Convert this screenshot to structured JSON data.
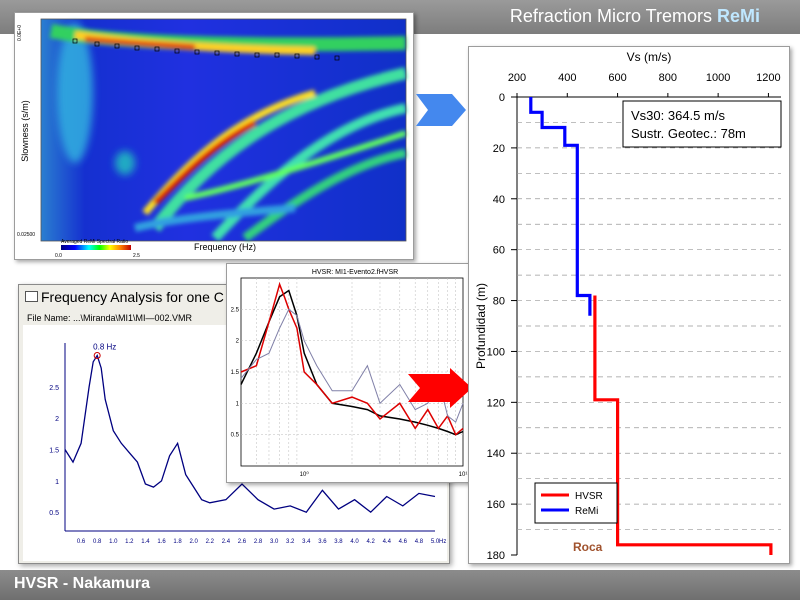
{
  "header": {
    "title_main": "Refraction Micro Tremors",
    "title_accent": "ReMi"
  },
  "footer": {
    "title": "HVSR - Nakamura"
  },
  "remi_panel": {
    "ylabel": "Slowness (s/m)",
    "xlabel": "Frequency (Hz)",
    "y_top": "0.0E+0",
    "y_bottom": "0.02500",
    "colorbar_label": "Averaged ReMi Spectral Ratio",
    "colorbar_min": "0.0",
    "colorbar_max": "2.5"
  },
  "freq_window": {
    "title": "Frequency Analysis for one C",
    "file_name": "File Name: ...\\Miranda\\MI1\\MI—002.VMR",
    "peak_label": "0.8 Hz"
  },
  "hvsr_inset": {
    "title": "HVSR: MI1-Evento2.fHVSR"
  },
  "profile": {
    "annotation_line1": "Vs30: 364.5 m/s",
    "annotation_line2": "Sustr. Geotec.: 78m",
    "rock_label": "Roca"
  },
  "chart_data": [
    {
      "type": "line",
      "id": "vs-profile",
      "title": "",
      "xlabel": "Vs (m/s)",
      "ylabel": "Profundidad (m)",
      "xlim": [
        200,
        1250
      ],
      "ylim": [
        0,
        180
      ],
      "x_ticks": [
        200,
        400,
        600,
        800,
        1000,
        1200
      ],
      "y_ticks": [
        0,
        20,
        40,
        60,
        80,
        100,
        120,
        140,
        160,
        180
      ],
      "y_inverted": true,
      "grid": true,
      "legend_position": "bottom-left",
      "series": [
        {
          "name": "HVSR",
          "color": "#ff0000",
          "points": [
            [
              510,
              78
            ],
            [
              510,
              119
            ],
            [
              600,
              119
            ],
            [
              600,
              176
            ],
            [
              1210,
              176
            ],
            [
              1210,
              180
            ]
          ]
        },
        {
          "name": "ReMi",
          "color": "#0000ff",
          "points": [
            [
              255,
              0
            ],
            [
              255,
              6
            ],
            [
              300,
              6
            ],
            [
              300,
              12
            ],
            [
              390,
              12
            ],
            [
              390,
              19
            ],
            [
              440,
              19
            ],
            [
              440,
              78
            ],
            [
              490,
              78
            ],
            [
              490,
              86
            ]
          ]
        }
      ]
    },
    {
      "type": "line",
      "id": "hv-spectrum",
      "title": "",
      "xlabel": "",
      "ylabel": "",
      "xlim": [
        0.4,
        5.0
      ],
      "ylim": [
        0.2,
        3.2
      ],
      "x_tick_labels": [
        "0.6",
        "0.8",
        "1.0",
        "1.2",
        "1.4",
        "1.6",
        "1.8",
        "2.0",
        "2.2",
        "2.4",
        "2.6",
        "2.8",
        "3.0",
        "3.2",
        "3.4",
        "3.6",
        "3.8",
        "4.0",
        "4.2",
        "4.4",
        "4.6",
        "4.8",
        "5.0"
      ],
      "x_unit": "Hz",
      "y_ticks": [
        0.5,
        1.0,
        1.5,
        2.0,
        2.5
      ],
      "series": [
        {
          "name": "",
          "color": "#000080",
          "x": [
            0.4,
            0.5,
            0.6,
            0.7,
            0.75,
            0.8,
            0.85,
            0.9,
            1.0,
            1.1,
            1.2,
            1.3,
            1.4,
            1.5,
            1.6,
            1.7,
            1.8,
            1.9,
            2.0,
            2.1,
            2.2,
            2.4,
            2.6,
            2.8,
            3.0,
            3.2,
            3.4,
            3.6,
            3.8,
            4.0,
            4.2,
            4.4,
            4.6,
            4.8,
            5.0
          ],
          "y": [
            1.5,
            1.3,
            1.6,
            2.5,
            2.9,
            3.0,
            2.8,
            2.3,
            1.8,
            1.6,
            1.45,
            1.3,
            0.95,
            0.9,
            1.0,
            1.4,
            1.6,
            1.1,
            0.9,
            0.7,
            0.65,
            0.7,
            0.95,
            0.7,
            0.55,
            0.6,
            0.5,
            0.85,
            0.55,
            0.7,
            0.5,
            0.75,
            0.6,
            0.8,
            0.75
          ]
        }
      ]
    },
    {
      "type": "line",
      "id": "hvsr-inset",
      "title": "HVSR: MI1-Evento2.fHVSR",
      "xlabel": "",
      "ylabel": "",
      "x_scale": "log",
      "xlim": [
        0.4,
        10
      ],
      "ylim": [
        0,
        3
      ],
      "y_ticks": [
        0.5,
        1,
        1.5,
        2,
        2.5
      ],
      "x_tick_labels": [
        "10⁰",
        "10¹"
      ],
      "series": [
        {
          "name": "",
          "color": "#000000",
          "x": [
            0.4,
            0.5,
            0.6,
            0.7,
            0.8,
            0.9,
            1.0,
            1.2,
            1.5,
            2,
            2.5,
            3,
            4,
            5,
            6,
            7,
            8,
            9,
            10
          ],
          "y": [
            1.3,
            1.8,
            2.3,
            2.7,
            2.8,
            2.4,
            1.8,
            1.3,
            1.0,
            0.95,
            0.9,
            0.8,
            0.75,
            0.7,
            0.65,
            0.6,
            0.55,
            0.5,
            0.55
          ]
        },
        {
          "name": "",
          "color": "#dd0000",
          "x": [
            0.4,
            0.5,
            0.6,
            0.7,
            0.75,
            0.8,
            0.9,
            1.0,
            1.2,
            1.5,
            2,
            2.5,
            3,
            4,
            5,
            6,
            7,
            8,
            9,
            10
          ],
          "y": [
            1.5,
            1.6,
            2.3,
            2.9,
            2.7,
            2.5,
            2.2,
            1.5,
            1.3,
            1.0,
            1.1,
            1.0,
            0.75,
            1.0,
            0.6,
            0.9,
            0.6,
            0.8,
            0.5,
            0.6
          ]
        },
        {
          "name": "",
          "color": "#8080a8",
          "x": [
            0.4,
            0.5,
            0.6,
            0.7,
            0.8,
            0.9,
            1.0,
            1.2,
            1.5,
            2,
            2.5,
            3,
            4,
            5,
            6,
            7,
            8,
            9,
            10
          ],
          "y": [
            1.4,
            1.7,
            1.8,
            2.2,
            2.5,
            2.4,
            2.0,
            1.6,
            1.2,
            1.2,
            1.6,
            1.0,
            1.3,
            0.9,
            1.0,
            1.4,
            0.8,
            0.7,
            1.0
          ]
        }
      ]
    }
  ]
}
